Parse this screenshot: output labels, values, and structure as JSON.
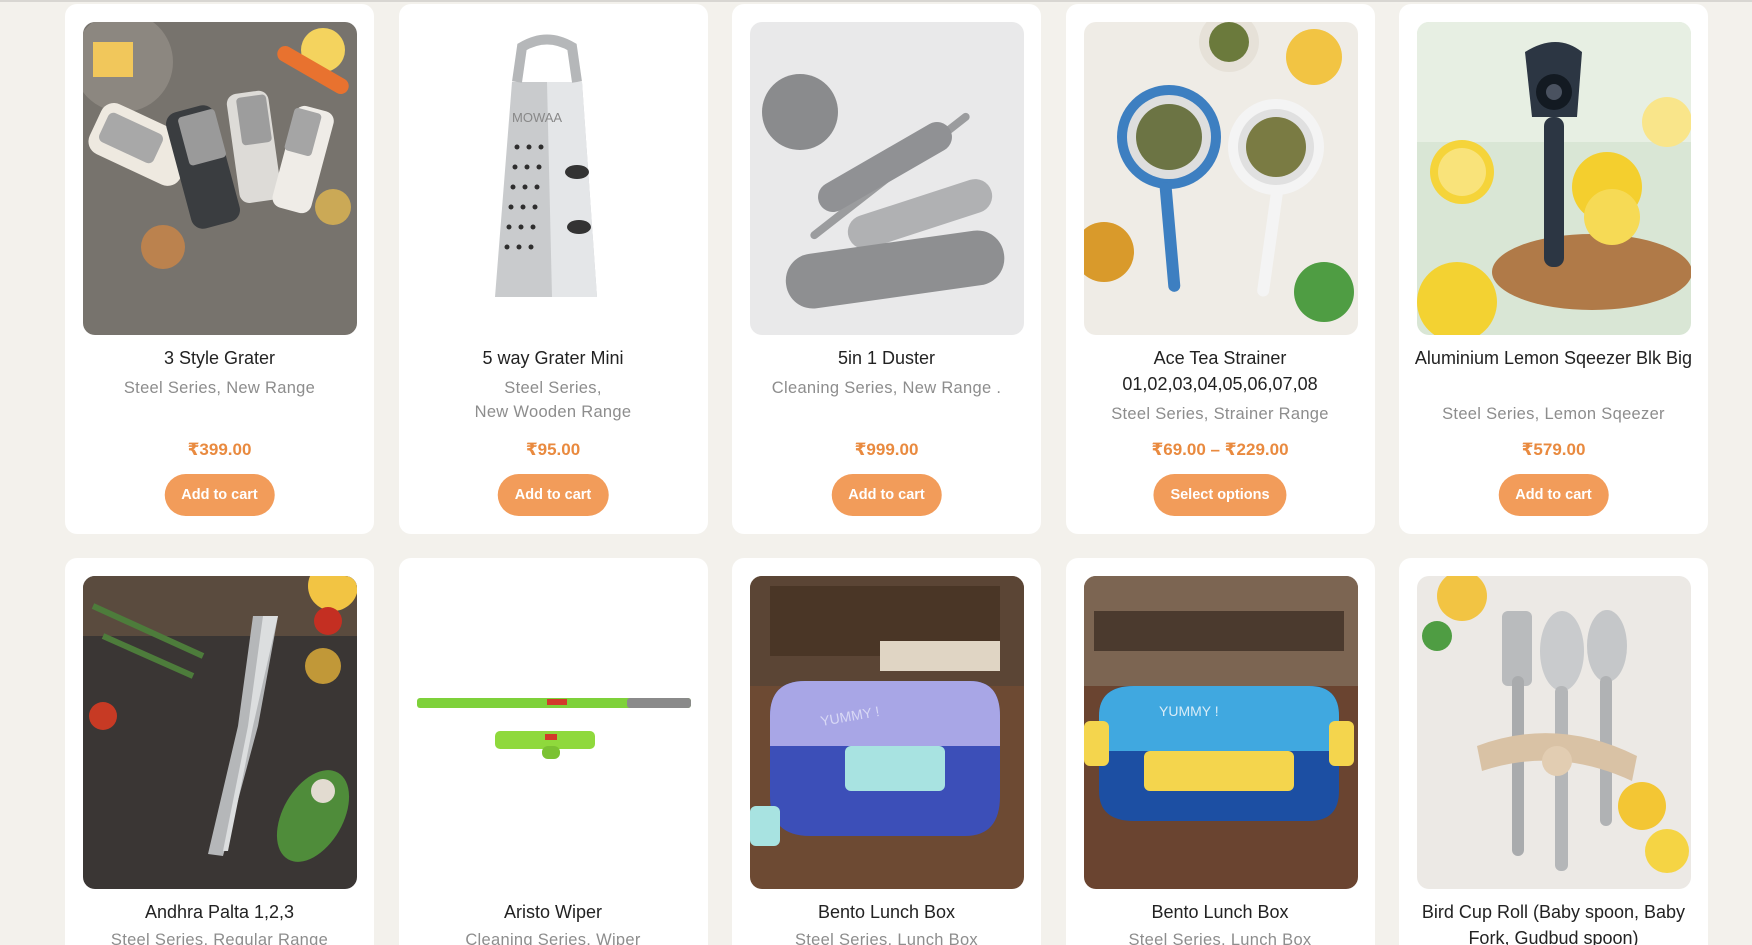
{
  "products": [
    {
      "title": "3 Style Grater",
      "categories": [
        "Steel Series, New Range"
      ],
      "price": "₹399.00",
      "button": "Add to cart",
      "image_icon": "graters-image"
    },
    {
      "title": "5 way Grater Mini",
      "categories": [
        "Steel Series,",
        "New Wooden Range"
      ],
      "price": "₹95.00",
      "button": "Add to cart",
      "image_icon": "box-grater-image"
    },
    {
      "title": "5in 1 Duster",
      "categories": [
        "Cleaning Series, New Range ."
      ],
      "price": "₹999.00",
      "button": "Add to cart",
      "image_icon": "duster-image"
    },
    {
      "title": "Ace Tea Strainer 01,02,03,04,05,06,07,08",
      "categories": [
        "Steel Series, Strainer Range"
      ],
      "price": "₹69.00 – ₹229.00",
      "button": "Select options",
      "image_icon": "tea-strainer-image"
    },
    {
      "title": "Aluminium Lemon Sqeezer Blk Big",
      "categories": [
        "Steel Series, Lemon Sqeezer"
      ],
      "price": "₹579.00",
      "button": "Add to cart",
      "image_icon": "lemon-squeezer-image"
    },
    {
      "title": "Andhra Palta 1,2,3",
      "categories": [
        "Steel Series, Regular Range"
      ],
      "image_icon": "palta-image"
    },
    {
      "title": "Aristo Wiper",
      "categories": [
        "Cleaning Series, Wiper"
      ],
      "image_icon": "wiper-image"
    },
    {
      "title": "Bento Lunch Box",
      "categories": [
        "Steel Series, Lunch Box"
      ],
      "image_icon": "bento-purple-image"
    },
    {
      "title": "Bento Lunch Box",
      "categories": [
        "Steel Series, Lunch Box"
      ],
      "image_icon": "bento-blue-image"
    },
    {
      "title": "Bird Cup Roll (Baby spoon, Baby Fork, Gudbud spoon)",
      "categories": [],
      "image_icon": "cutlery-image"
    }
  ],
  "colors": {
    "accent": "#f29c5a",
    "price": "#e98a3f"
  }
}
